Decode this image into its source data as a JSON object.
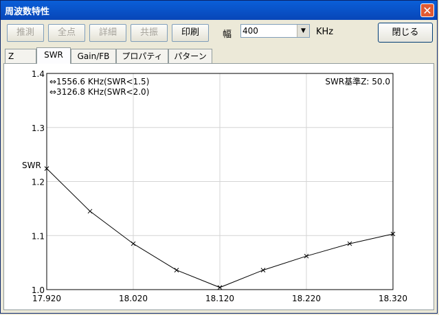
{
  "window": {
    "title": "周波数特性",
    "close_glyph": "✕"
  },
  "toolbar": {
    "buttons": [
      {
        "label": "推測",
        "enabled": false
      },
      {
        "label": "全点",
        "enabled": false
      },
      {
        "label": "詳細",
        "enabled": false
      },
      {
        "label": "共振",
        "enabled": false
      },
      {
        "label": "印刷",
        "enabled": true
      }
    ],
    "width_label": "幅",
    "width_value": "400",
    "unit_label": "KHz",
    "close_label": "閉じる"
  },
  "tabs": [
    {
      "label": "Z",
      "active": false
    },
    {
      "label": "SWR",
      "active": true
    },
    {
      "label": "Gain/FB",
      "active": false
    },
    {
      "label": "プロパティ",
      "active": false
    },
    {
      "label": "パターン",
      "active": false
    }
  ],
  "chart_data": {
    "type": "line",
    "ylabel": "SWR",
    "xlabel": "",
    "xlim": [
      17.92,
      18.32
    ],
    "ylim": [
      1.0,
      1.4
    ],
    "x_ticks": [
      "17.920",
      "18.020",
      "18.120",
      "18.220",
      "18.320"
    ],
    "y_ticks": [
      "1.0",
      "1.1",
      "1.2",
      "1.3",
      "1.4"
    ],
    "grid": true,
    "annotations": [
      "⇔1556.6 KHz(SWR<1.5)",
      "⇔3126.8 KHz(SWR<2.0)"
    ],
    "reference_label": "SWR基準Z: 50.0",
    "series": [
      {
        "x": [
          17.92,
          17.97,
          18.02,
          18.07,
          18.12,
          18.17,
          18.22,
          18.27,
          18.32
        ],
        "values": [
          1.224,
          1.145,
          1.085,
          1.036,
          1.004,
          1.036,
          1.062,
          1.085,
          1.103
        ]
      }
    ]
  }
}
